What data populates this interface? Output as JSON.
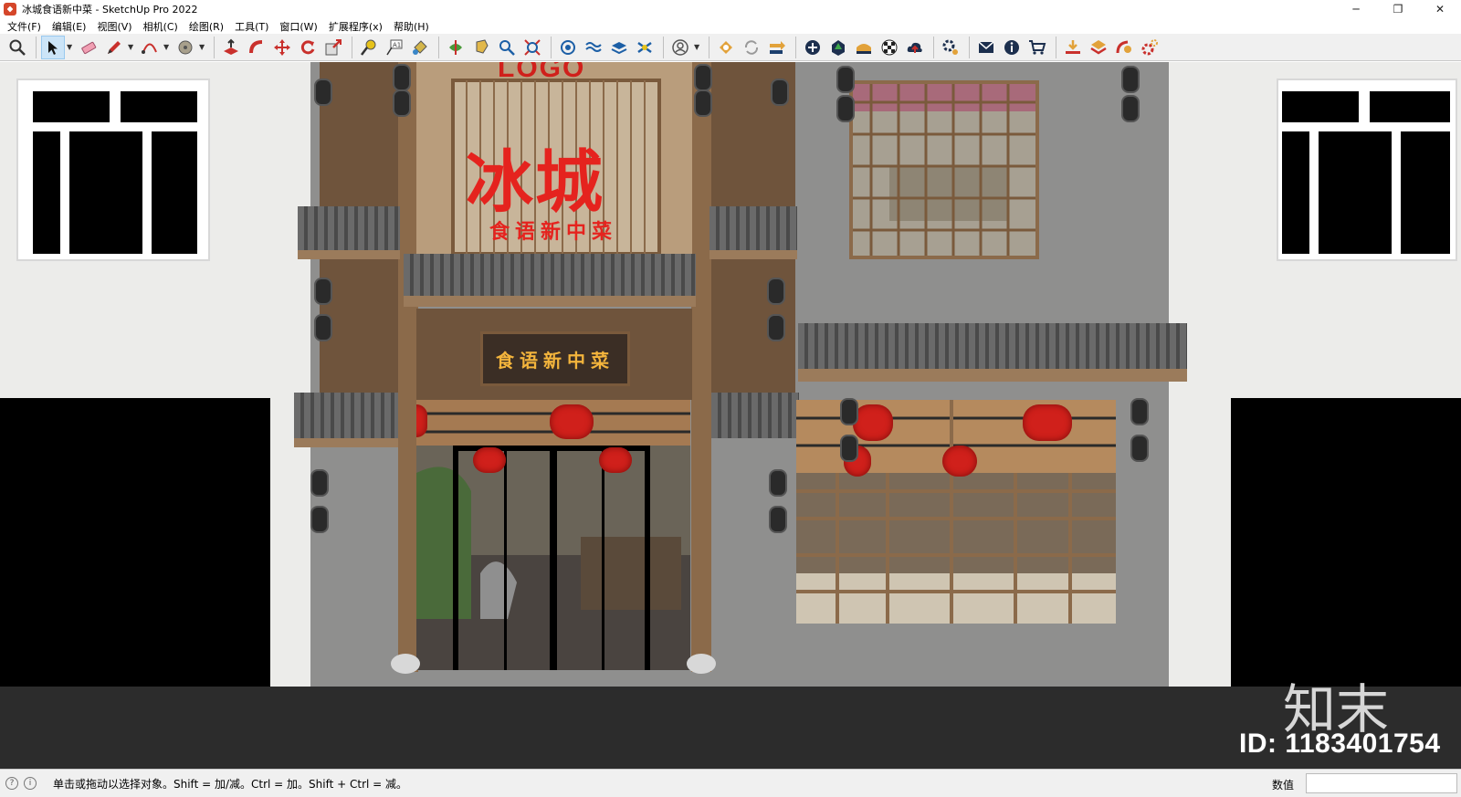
{
  "window": {
    "title": "冰城食语新中菜 - SketchUp Pro 2022",
    "minimize": "─",
    "restore": "❐",
    "close": "✕"
  },
  "menu": [
    "文件(F)",
    "编辑(E)",
    "视图(V)",
    "相机(C)",
    "绘图(R)",
    "工具(T)",
    "窗口(W)",
    "扩展程序(x)",
    "帮助(H)"
  ],
  "toolbar": {
    "tools": [
      "zoom-extents-icon",
      "select-icon",
      "eraser-icon",
      "pencil-icon",
      "arc-icon",
      "paint-bucket-icon",
      "push-pull-icon",
      "follow-me-icon",
      "move-icon",
      "rotate-icon",
      "scale-icon",
      "tape-measure-icon",
      "text-icon",
      "paint-icon",
      "orbit-icon",
      "walk-icon",
      "zoom-icon",
      "zoom-window-icon",
      "section-icon",
      "sandbox-icon",
      "layers-icon",
      "tags-icon",
      "account-icon",
      "extension-warehouse-icon",
      "sync-icon",
      "export-icon",
      "add-icon",
      "tree-icon",
      "building-icon",
      "checker-icon",
      "upload-icon",
      "settings-icon",
      "mail-icon",
      "info-icon",
      "cart-icon",
      "download-icon",
      "component-icon",
      "plugin-icon",
      "gear-icon"
    ]
  },
  "scene": {
    "logo": "LOGO",
    "main_title": "冰城",
    "sub_title": "食语新中菜",
    "sign_board": "食语新中菜"
  },
  "watermark": {
    "brand": "知末",
    "id": "ID: 1183401754"
  },
  "status": {
    "message": "单击或拖动以选择对象。Shift = 加/减。Ctrl = 加。Shift + Ctrl = 减。",
    "measurements_label": "数值",
    "measurements_value": ""
  },
  "colors": {
    "accent_red": "#e5231e",
    "sign_gold": "#f3b43c",
    "wood": "#8b6a4a"
  }
}
